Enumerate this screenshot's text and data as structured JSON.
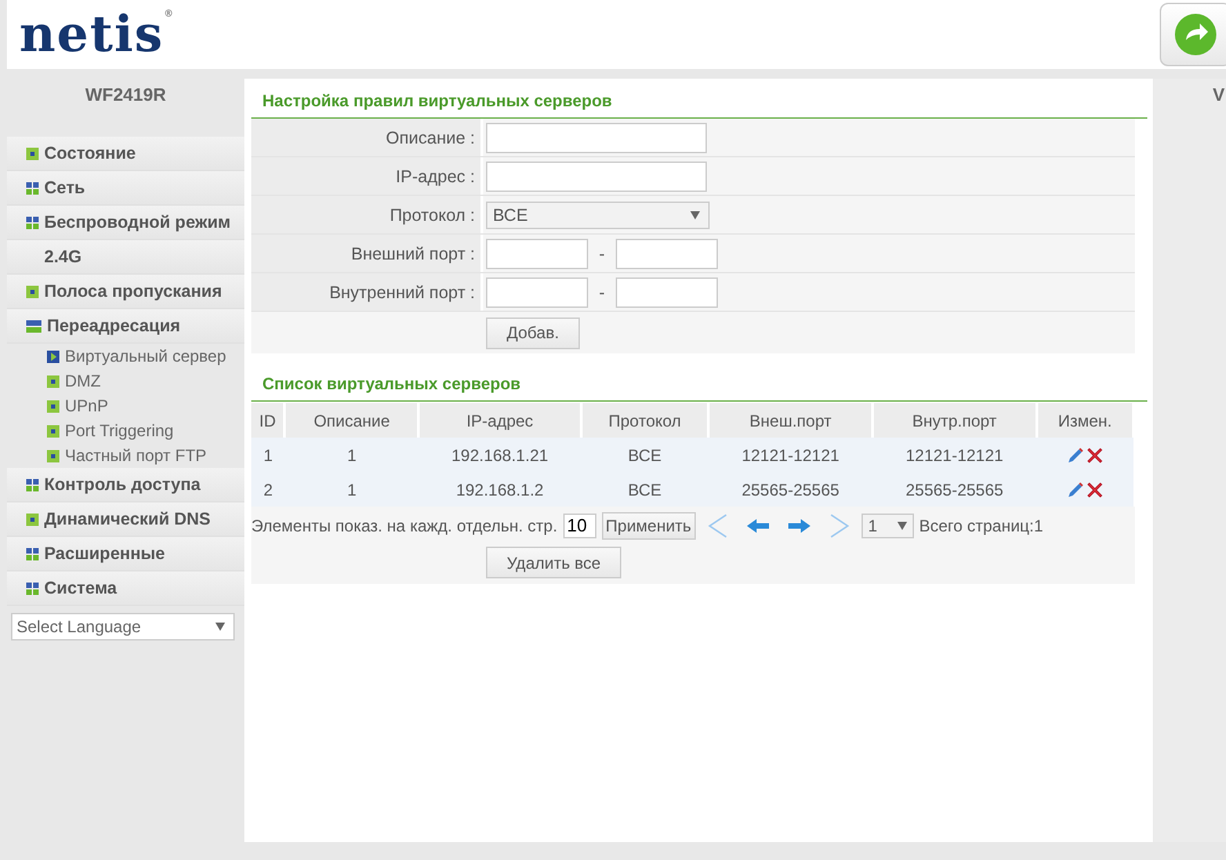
{
  "header": {
    "logo": "netis",
    "trademark": "®"
  },
  "sidebar": {
    "model": "WF2419R",
    "items": [
      {
        "label": "Состояние",
        "kind": "leaf"
      },
      {
        "label": "Сеть",
        "kind": "group"
      },
      {
        "label": "Беспроводной режим",
        "kind": "group"
      },
      {
        "label": "2.4G",
        "kind": "heading"
      },
      {
        "label": "Полоса пропускания",
        "kind": "leaf"
      },
      {
        "label": "Переадресация",
        "kind": "expanded",
        "children": [
          {
            "label": "Виртуальный сервер",
            "selected": true
          },
          {
            "label": "DMZ",
            "selected": false
          },
          {
            "label": "UPnP",
            "selected": false
          },
          {
            "label": "Port Triggering",
            "selected": false
          },
          {
            "label": "Частный порт FTP",
            "selected": false
          }
        ]
      },
      {
        "label": "Контроль доступа",
        "kind": "group"
      },
      {
        "label": "Динамический DNS",
        "kind": "leaf"
      },
      {
        "label": "Расширенные",
        "kind": "group"
      },
      {
        "label": "Система",
        "kind": "group"
      }
    ],
    "language": "Select Language"
  },
  "form": {
    "title": "Настройка правил виртуальных серверов",
    "fields": [
      {
        "label": "Описание :",
        "kind": "text"
      },
      {
        "label": "IP-адрес :",
        "kind": "text"
      },
      {
        "label": "Протокол :",
        "kind": "select",
        "value": "ВСЕ"
      },
      {
        "label": "Внешний порт :",
        "kind": "range",
        "separator": "-"
      },
      {
        "label": "Внутренний порт :",
        "kind": "range",
        "separator": "-"
      }
    ],
    "button": "Добав."
  },
  "list": {
    "title": "Список виртуальных серверов",
    "columns": [
      "ID",
      "Описание",
      "IP-адрес",
      "Протокол",
      "Внеш.порт",
      "Внутр.порт",
      "Измен."
    ],
    "rows": [
      [
        "1",
        "1",
        "192.168.1.21",
        "ВСЕ",
        "12121-12121",
        "12121-12121"
      ],
      [
        "2",
        "1",
        "192.168.1.2",
        "ВСЕ",
        "25565-25565",
        "25565-25565"
      ]
    ],
    "pager": {
      "label": "Элементы показ. на кажд. отдельн. стр.",
      "per_page": "10",
      "apply": "Применить",
      "page": "1",
      "total": "Всего страниц:1"
    },
    "delete_all": "Удалить все"
  },
  "right_panel": {
    "text": "V"
  }
}
